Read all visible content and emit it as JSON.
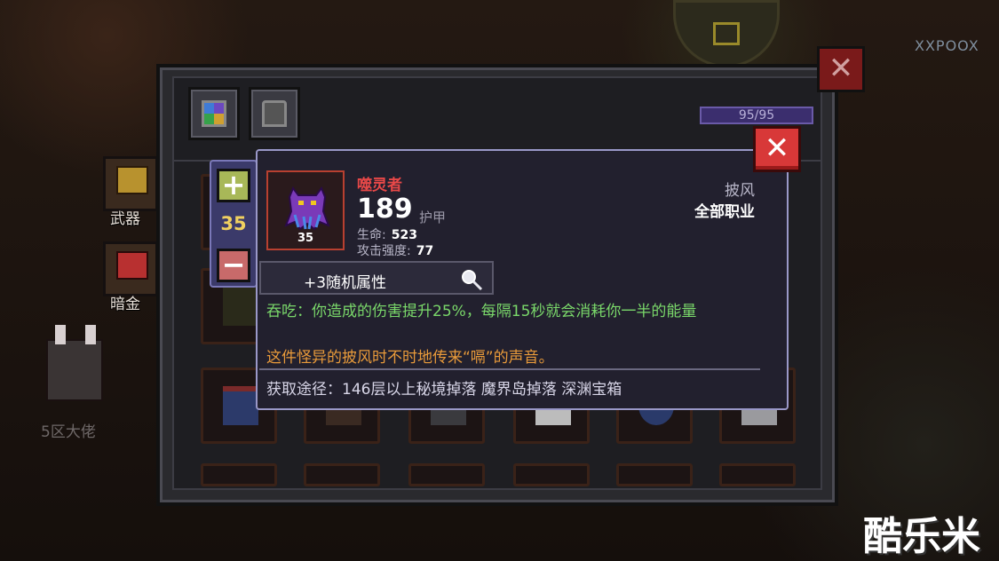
{
  "background": {
    "corner_text": "XXPOOX",
    "character_name": "5区大佬",
    "side_buttons": [
      {
        "label": "武器",
        "icon": "weapon-chest-icon"
      },
      {
        "label": "暗金",
        "icon": "dark-gold-icon"
      }
    ]
  },
  "inventory": {
    "tabs": [
      {
        "icon": "all-items-grid-icon"
      },
      {
        "icon": "armor-helmet-icon"
      }
    ],
    "capacity_text": "95/95",
    "capacity_fill": 1.0,
    "close_label": "✕"
  },
  "quantity": {
    "plus_label": "+",
    "minus_label": "−",
    "value": "35"
  },
  "item": {
    "name": "噬灵者",
    "level": "35",
    "armor_value": "189",
    "armor_label": "护甲",
    "stats": [
      {
        "label": "生命:",
        "value": "523"
      },
      {
        "label": "攻击强度:",
        "value": "77"
      }
    ],
    "type": "披风",
    "class_restriction": "全部职业",
    "random_attr_label": "+3随机属性",
    "effect": "吞吃：你造成的伤害提升25%，每隔15秒就会消耗你一半的能量",
    "flavor": "这件怪异的披风时不时地传来“嗝”的声音。",
    "source": "获取途径：146层以上秘境掉落 魔界岛掉落 深渊宝箱",
    "close_label": "✕",
    "colors": {
      "name": "#e84848",
      "effect": "#7ad86a",
      "flavor": "#e89a3a"
    }
  },
  "watermark": "酷乐米"
}
